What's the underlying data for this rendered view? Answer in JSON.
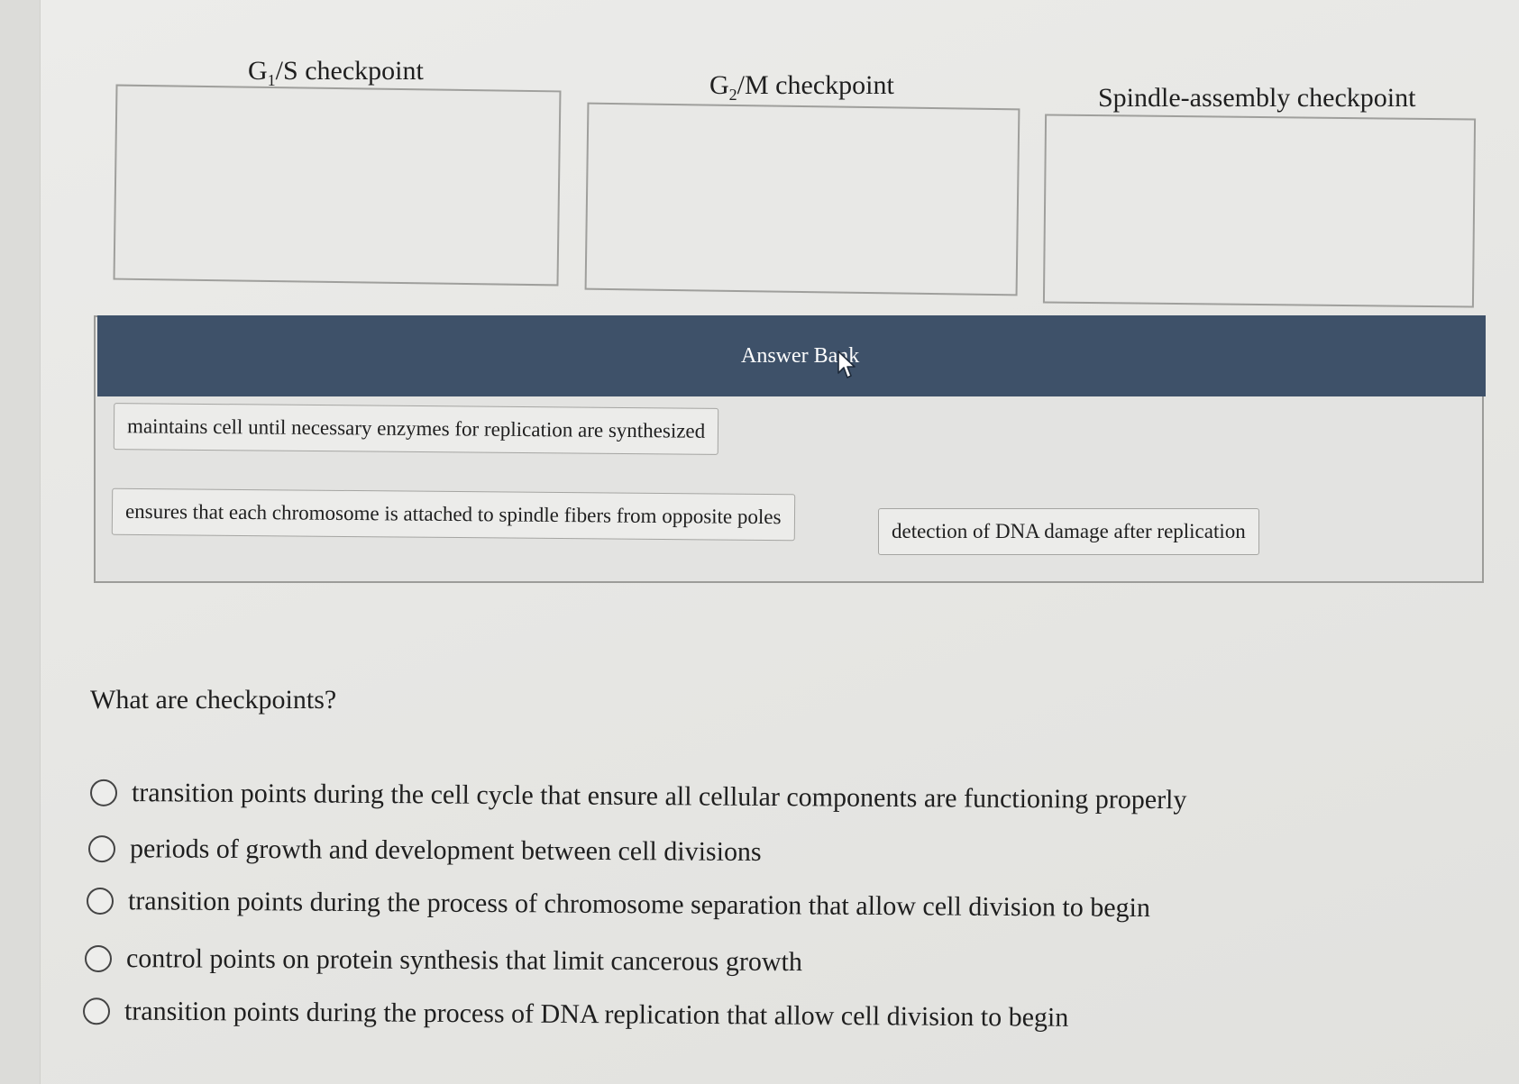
{
  "targets": [
    {
      "prefix": "G",
      "sub": "1",
      "suffix": "/S checkpoint"
    },
    {
      "prefix": "G",
      "sub": "2",
      "suffix": "/M checkpoint"
    },
    {
      "prefix": "",
      "sub": "",
      "suffix": "Spindle-assembly checkpoint"
    }
  ],
  "answer_bank": {
    "title": "Answer Bank",
    "items": [
      "maintains cell until necessary enzymes for replication are synthesized",
      "ensures that each chromosome is attached to spindle fibers from opposite poles",
      "detection of DNA damage after replication"
    ]
  },
  "question": {
    "text": "What are checkpoints?",
    "options": [
      "transition points during the cell cycle that ensure all cellular components are functioning properly",
      "periods of growth and development between cell divisions",
      "transition points during the process of chromosome separation that allow cell division to begin",
      "control points on protein synthesis that limit cancerous growth",
      "transition points during the process of DNA replication that allow cell division to begin"
    ]
  },
  "colors": {
    "bank_header": "#3e5169",
    "background": "#e9e9e7"
  }
}
